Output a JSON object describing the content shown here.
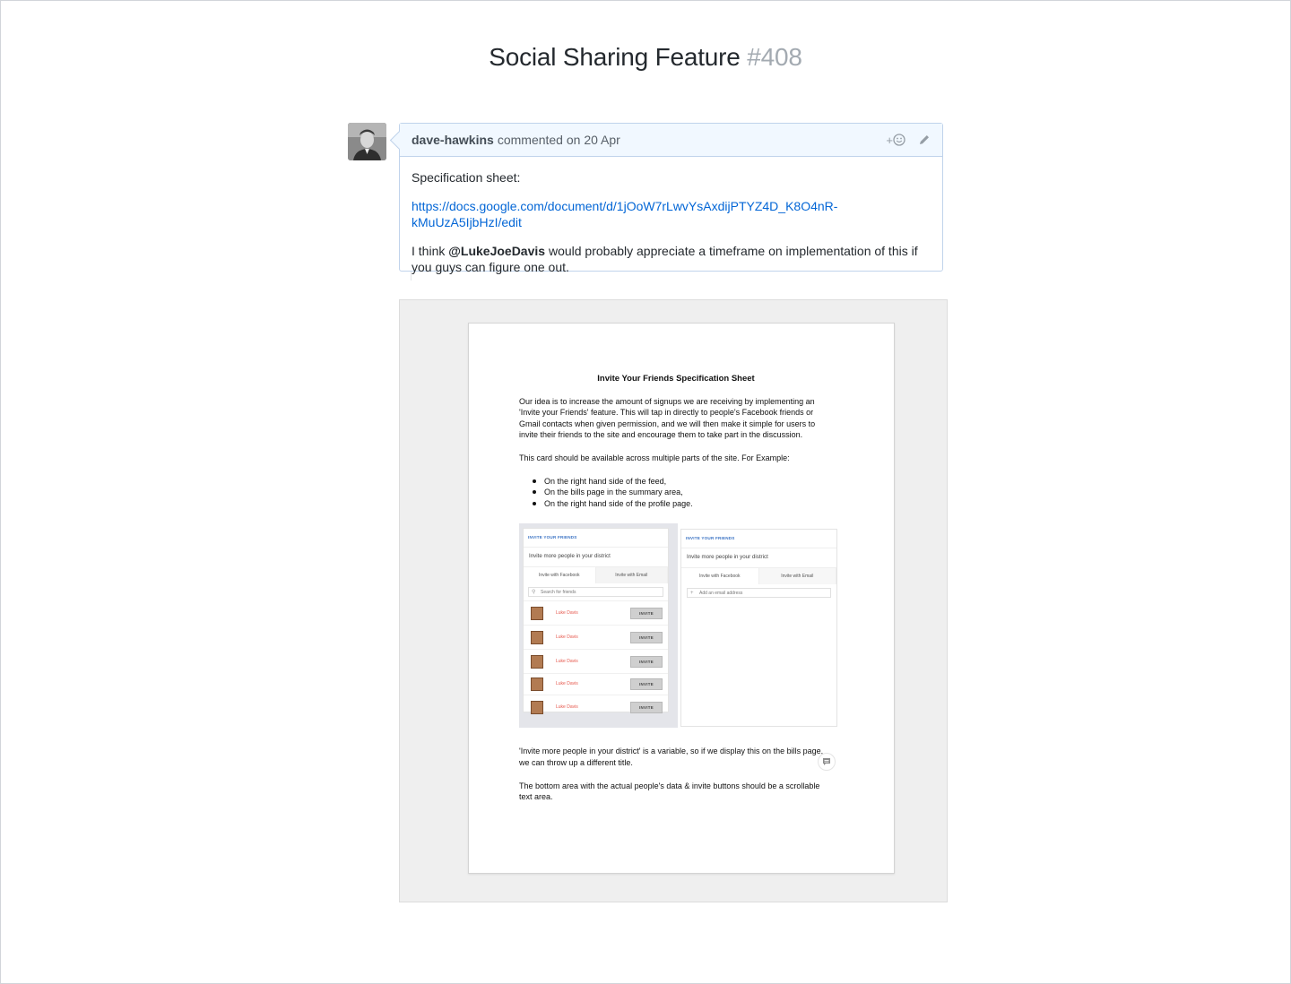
{
  "issue": {
    "title": "Social Sharing Feature",
    "number": "#408"
  },
  "comment": {
    "author": "dave-hawkins",
    "meta": "commented on 20 Apr",
    "reaction_label": "+",
    "body_intro": "Specification sheet:",
    "link": "https://docs.google.com/document/d/1jOoW7rLwvYsAxdijPTYZ4D_K8O4nR-kMuUzA5IjbHzI/edit",
    "text_before_mention": "I think ",
    "mention": "@LukeJoeDavis",
    "text_after_mention": " would probably appreciate a timeframe on implementation of this if you guys can figure one out."
  },
  "icons": {
    "reaction": "smiley-icon",
    "edit": "pencil-icon",
    "page_badge": "comment-icon"
  },
  "document": {
    "title": "Invite Your Friends Specification Sheet",
    "para1": "Our idea is to increase the amount of signups we are receiving by implementing an 'Invite your Friends' feature. This will tap in directly to people's Facebook friends or Gmail contacts when given permission, and we will then make it simple for users to invite their friends to the site and encourage them to take part in the discussion.",
    "para2": "This card should be available across multiple parts of the site. For Example:",
    "bullets": [
      "On the right hand side of the feed,",
      "On the bills page in the summary area,",
      "On the right hand side of the profile page."
    ],
    "para3": "'Invite more people in your district' is a variable, so if we display this on the bills page, we can throw up a different title.",
    "para4": "The bottom area with the actual people's data & invite buttons should be a scrollable text area."
  },
  "mockup_facebook": {
    "title": "INVITE YOUR FRIENDS",
    "subtitle": "Invite more people in your district",
    "tab_facebook": "Invite with Facebook",
    "tab_email": "Invite with Email",
    "search_placeholder": "Search for friends",
    "friends": [
      {
        "name": "Luke Davis",
        "button": "INVITE"
      },
      {
        "name": "Luke Davis",
        "button": "INVITE"
      },
      {
        "name": "Luke Davis",
        "button": "INVITE"
      },
      {
        "name": "Luke Davis",
        "button": "INVITE"
      },
      {
        "name": "Luke Davis",
        "button": "INVITE"
      }
    ]
  },
  "mockup_email": {
    "title": "INVITE YOUR FRIENDS",
    "subtitle": "Invite more people in your district",
    "tab_facebook": "Invite with Facebook",
    "tab_email": "Invite with Email",
    "add_email_placeholder": "Add an email address"
  },
  "colors": {
    "link": "#0366d6",
    "header_bg": "#f1f8ff",
    "header_border": "#c0d3eb",
    "title_number": "#a3aab1",
    "mock_accent": "#3b73c4",
    "friend_name": "#e6584d"
  }
}
